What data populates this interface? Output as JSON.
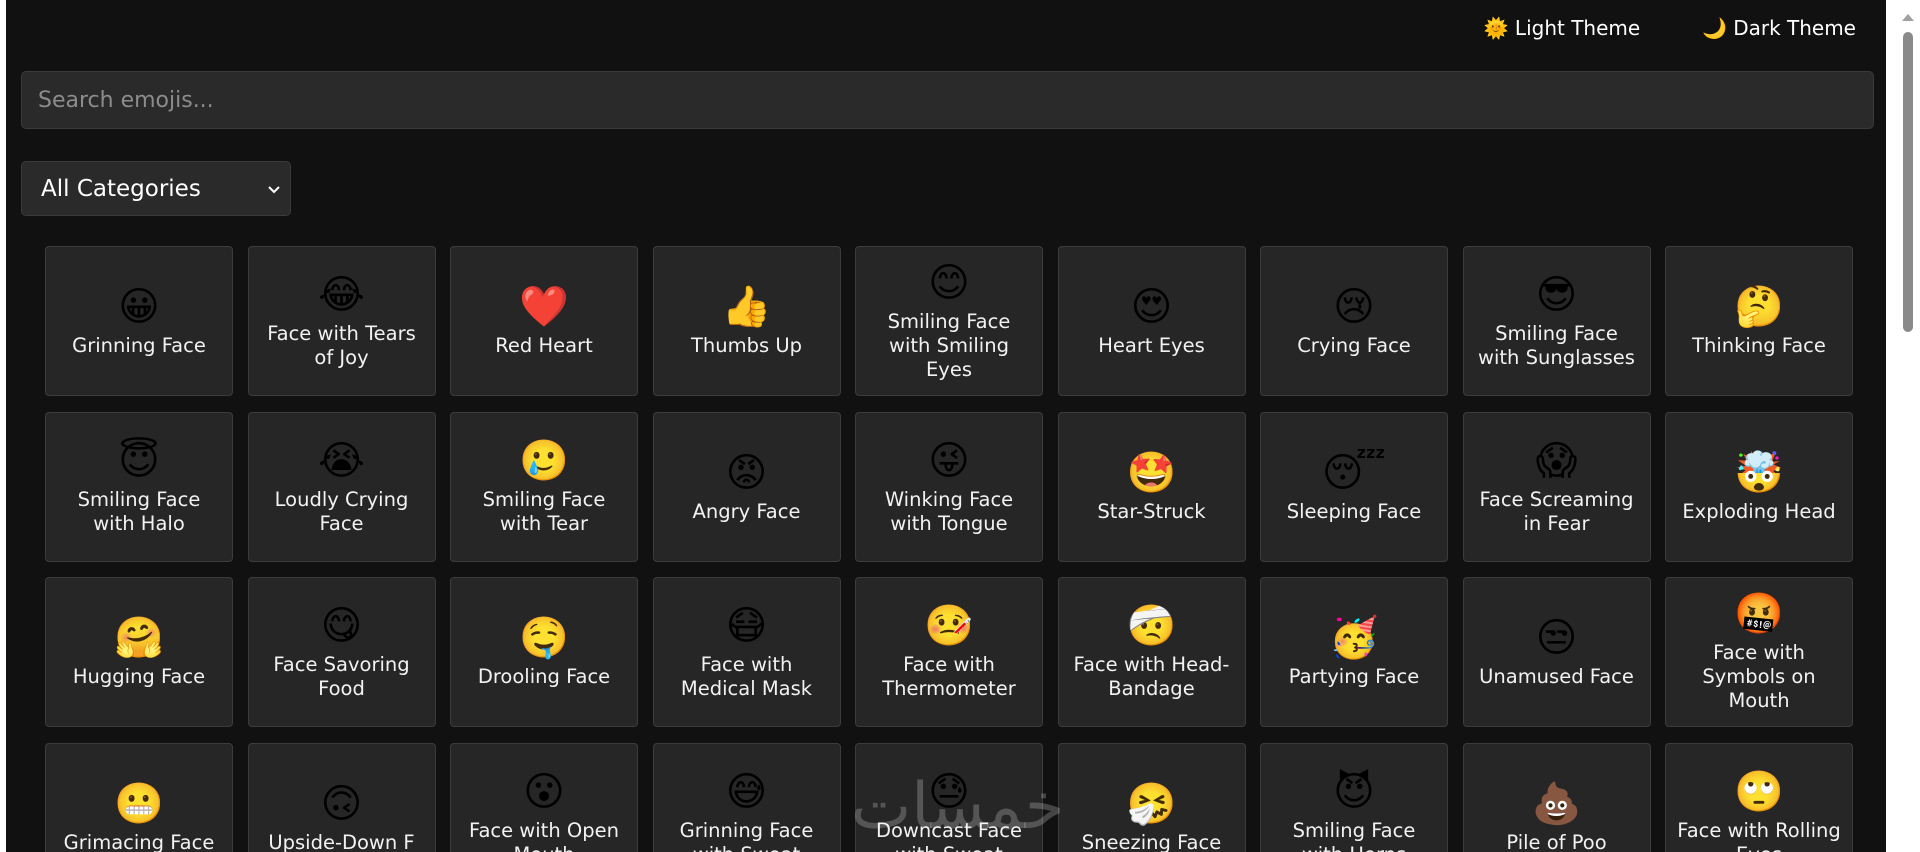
{
  "theme_toggle": {
    "light": {
      "icon": "🌞",
      "label": "Light Theme"
    },
    "dark": {
      "icon": "🌙",
      "label": "Dark Theme"
    }
  },
  "search": {
    "placeholder": "Search emojis...",
    "value": ""
  },
  "category_select": {
    "selected": "All Categories"
  },
  "emojis": [
    {
      "emoji": "😀",
      "name": "Grinning Face"
    },
    {
      "emoji": "😂",
      "name": "Face with Tears of Joy"
    },
    {
      "emoji": "❤️",
      "name": "Red Heart"
    },
    {
      "emoji": "👍",
      "name": "Thumbs Up"
    },
    {
      "emoji": "😊",
      "name": "Smiling Face with Smiling Eyes"
    },
    {
      "emoji": "😍",
      "name": "Heart Eyes"
    },
    {
      "emoji": "😢",
      "name": "Crying Face"
    },
    {
      "emoji": "😎",
      "name": "Smiling Face with Sunglasses"
    },
    {
      "emoji": "🤔",
      "name": "Thinking Face"
    },
    {
      "emoji": "😇",
      "name": "Smiling Face with Halo"
    },
    {
      "emoji": "😭",
      "name": "Loudly Crying Face"
    },
    {
      "emoji": "🥲",
      "name": "Smiling Face with Tear"
    },
    {
      "emoji": "😡",
      "name": "Angry Face"
    },
    {
      "emoji": "😜",
      "name": "Winking Face with Tongue"
    },
    {
      "emoji": "🤩",
      "name": "Star-Struck"
    },
    {
      "emoji": "😴",
      "name": "Sleeping Face"
    },
    {
      "emoji": "😱",
      "name": "Face Screaming in Fear"
    },
    {
      "emoji": "🤯",
      "name": "Exploding Head"
    },
    {
      "emoji": "🤗",
      "name": "Hugging Face"
    },
    {
      "emoji": "😋",
      "name": "Face Savoring Food"
    },
    {
      "emoji": "🤤",
      "name": "Drooling Face"
    },
    {
      "emoji": "😷",
      "name": "Face with Medical Mask"
    },
    {
      "emoji": "🤒",
      "name": "Face with Thermometer"
    },
    {
      "emoji": "🤕",
      "name": "Face with Head-Bandage"
    },
    {
      "emoji": "🥳",
      "name": "Partying Face"
    },
    {
      "emoji": "😒",
      "name": "Unamused Face"
    },
    {
      "emoji": "🤬",
      "name": "Face with Symbols on Mouth"
    },
    {
      "emoji": "😬",
      "name": "Grimacing Face"
    },
    {
      "emoji": "🙃",
      "name": "Upside-Down F"
    },
    {
      "emoji": "😮",
      "name": "Face with Open Mouth"
    },
    {
      "emoji": "😅",
      "name": "Grinning Face with Sweat"
    },
    {
      "emoji": "😓",
      "name": "Downcast Face with Sweat"
    },
    {
      "emoji": "🤧",
      "name": "Sneezing Face"
    },
    {
      "emoji": "😈",
      "name": "Smiling Face with Horns"
    },
    {
      "emoji": "💩",
      "name": "Pile of Poo"
    },
    {
      "emoji": "🙄",
      "name": "Face with Rolling Eyes"
    }
  ],
  "watermark": "خمسات"
}
